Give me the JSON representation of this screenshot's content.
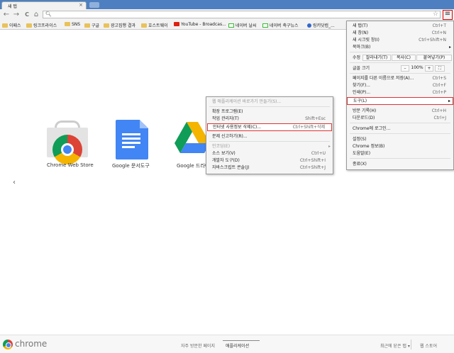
{
  "tab": {
    "title": "새 탭",
    "close_glyph": "×"
  },
  "toolbar": {
    "back_glyph": "←",
    "forward_glyph": "→",
    "reload_glyph": "C",
    "home_glyph": "⌂",
    "search_glyph": "🔍︎",
    "star_glyph": "☆",
    "menu_glyph": "≡"
  },
  "bookmarks": [
    {
      "label": "이패스",
      "icon": "folder-icon"
    },
    {
      "label": "링크프라이스",
      "icon": "folder-icon"
    },
    {
      "label": "SNS",
      "icon": "folder-icon"
    },
    {
      "label": "구글",
      "icon": "folder-icon"
    },
    {
      "label": "광고집행 결과",
      "icon": "folder-icon"
    },
    {
      "label": "호스트웨이",
      "icon": "folder-icon"
    },
    {
      "label": "YouTube - Broadcas...",
      "icon": "youtube-icon"
    },
    {
      "label": "네이버 날씨",
      "icon": "naver-icon"
    },
    {
      "label": "네이버 축구뉴스",
      "icon": "naver-icon"
    },
    {
      "label": "링키닷컴_...",
      "icon": "globe-icon"
    }
  ],
  "apps": [
    {
      "label": "Chrome Web Store"
    },
    {
      "label": "Google 문서도구"
    },
    {
      "label": "Google 드라이"
    }
  ],
  "left_arrow": "‹",
  "bottom": {
    "logo_text": "chrome",
    "most_visited": "자주 방문한 페이지",
    "apps": "애플리케이션",
    "recently_closed": "최근에 닫은 탭 ▾",
    "web_store": "웹 스토어"
  },
  "main_menu": {
    "items": [
      {
        "label": "새 탭(T)",
        "shortcut": "Ctrl+T"
      },
      {
        "label": "새 창(N)",
        "shortcut": "Ctrl+N"
      },
      {
        "label": "새 시크릿 창(I)",
        "shortcut": "Ctrl+Shift+N"
      },
      {
        "label": "북마크(B)",
        "shortcut": "",
        "arrow": "▸"
      }
    ],
    "edit": {
      "label": "수정",
      "cut": "잘라내기(T)",
      "copy": "복사(C)",
      "paste": "붙여넣기(P)"
    },
    "zoom": {
      "label": "글꼴 크기",
      "minus": "–",
      "value": "100%",
      "plus": "+",
      "fullscreen": "⛶"
    },
    "items2": [
      {
        "label": "페이지를 다른 이름으로 저장(A)...",
        "shortcut": "Ctrl+S"
      },
      {
        "label": "찾기(F)...",
        "shortcut": "Ctrl+F"
      },
      {
        "label": "인쇄(P)...",
        "shortcut": "Ctrl+P"
      }
    ],
    "tools": {
      "label": "도구(L)",
      "arrow": "▸"
    },
    "items3": [
      {
        "label": "방문 기록(H)",
        "shortcut": "Ctrl+H"
      },
      {
        "label": "다운로드(D)",
        "shortcut": "Ctrl+J"
      }
    ],
    "signin": "Chrome에 로그인...",
    "items4": [
      {
        "label": "설정(S)"
      },
      {
        "label": "Chrome 정보(B)"
      },
      {
        "label": "도움말(E)"
      }
    ],
    "exit": "종료(X)"
  },
  "tools_menu": {
    "items": [
      {
        "label": "웹 애플리케이션 바로가기 만들기(S)...",
        "shortcut": "",
        "disabled": true
      },
      {
        "label": "확장 프로그램(E)",
        "shortcut": ""
      },
      {
        "label": "작업 관리자(T)",
        "shortcut": "Shift+Esc"
      },
      {
        "label": "인터넷 사용정보 삭제(C)...",
        "shortcut": "Ctrl+Shift+삭제"
      },
      {
        "label": "문제 신고하기(R)...",
        "shortcut": ""
      },
      {
        "label": "인코딩(E)",
        "shortcut": "",
        "disabled": true,
        "arrow": "▸"
      },
      {
        "label": "소스 보기(V)",
        "shortcut": "Ctrl+U"
      },
      {
        "label": "개발자 도구(D)",
        "shortcut": "Ctrl+Shift+I"
      },
      {
        "label": "자바스크립트 콘솔(J)",
        "shortcut": "Ctrl+Shift+J"
      }
    ]
  }
}
